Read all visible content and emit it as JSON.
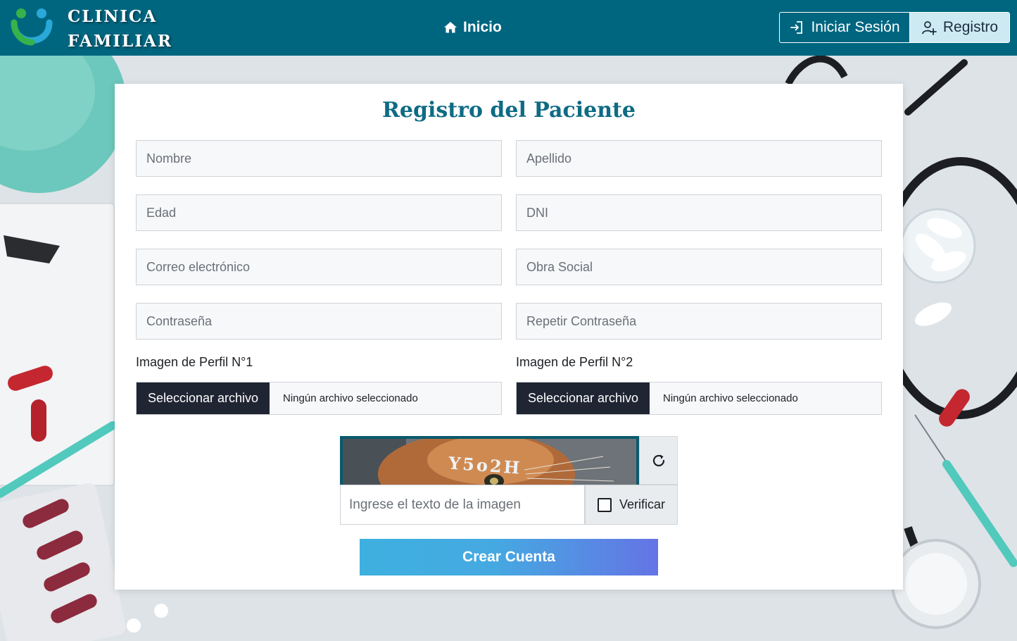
{
  "header": {
    "brand_line1": "CLINICA",
    "brand_line2": "FAMILIAR",
    "home_label": "Inicio",
    "login_label": "Iniciar Sesión",
    "register_label": "Registro"
  },
  "form": {
    "title": "Registro del Paciente",
    "fields": {
      "nombre": "Nombre",
      "apellido": "Apellido",
      "edad": "Edad",
      "dni": "DNI",
      "correo": "Correo electrónico",
      "obra_social": "Obra Social",
      "password": "Contraseña",
      "password_repeat": "Repetir Contraseña"
    },
    "file1": {
      "label": "Imagen de Perfil N°1",
      "button": "Seleccionar archivo",
      "status": "Ningún archivo seleccionado"
    },
    "file2": {
      "label": "Imagen de Perfil N°2",
      "button": "Seleccionar archivo",
      "status": "Ningún archivo seleccionado"
    },
    "captcha": {
      "code": "Y5o2H",
      "input_placeholder": "Ingrese el texto de la imagen",
      "verify_label": "Verificar"
    },
    "submit_label": "Crear Cuenta"
  },
  "colors": {
    "header_bg": "#006680",
    "title": "#0e6b84",
    "file_button": "#1f2533",
    "submit_start": "#3eb0e0",
    "submit_end": "#6474e5",
    "register_bg": "#cde9f2"
  },
  "icons": {
    "logo": "smile-logo-icon",
    "home": "home-icon",
    "login": "login-icon",
    "register": "user-plus-icon",
    "refresh": "refresh-icon"
  }
}
